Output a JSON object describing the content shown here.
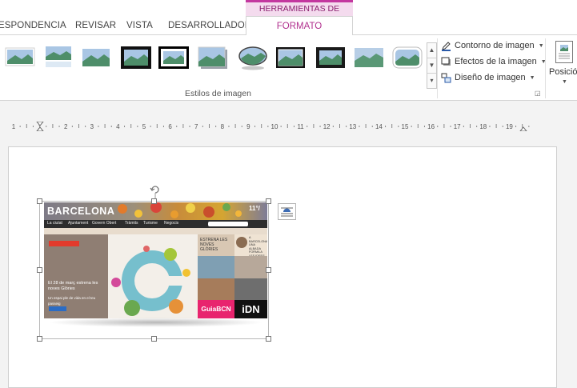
{
  "ribbon": {
    "tabs": [
      {
        "label": "ESPONDENCIA"
      },
      {
        "label": "REVISAR"
      },
      {
        "label": "VISTA"
      },
      {
        "label": "DESARROLLADOR"
      }
    ],
    "contextual_group": "HERRAMIENTAS DE IMAGEN",
    "active_tab": "FORMATO",
    "styles_group_label": "Estilos de imagen",
    "commands": {
      "border": "Contorno de imagen",
      "effects": "Efectos de la imagen",
      "layout": "Diseño de imagen"
    },
    "position_label": "Posició",
    "accent_color": "#b1308e"
  },
  "ruler": {
    "numbers": [
      "1",
      "1",
      "2",
      "3",
      "4",
      "5",
      "6",
      "7",
      "8",
      "9",
      "10",
      "11",
      "12",
      "13",
      "14",
      "15",
      "16",
      "17",
      "18",
      "19"
    ]
  },
  "image": {
    "site_title": "BARCELONA",
    "temperature": "11°/",
    "nav_items": [
      "La ciutat",
      "Ajuntament",
      "Govern Obert",
      "Tràmits",
      "Turisme",
      "Negocis"
    ],
    "hero_text": "El 28 de març estrena les noves Glòries",
    "hero_subtext": "Un espai ple de vida en el teu passeig",
    "tile_captions": [
      "ESTRENA LES NOVES GLÒRIES",
      "A BARCELONA UNA ALBADA FORMA A LES IDEES"
    ],
    "guia_label": "GuiaBCN",
    "idn_label": "iDN"
  }
}
